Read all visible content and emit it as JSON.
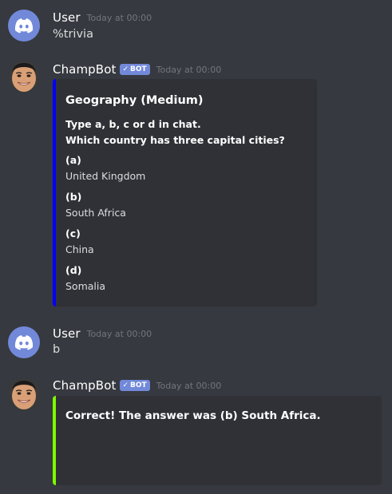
{
  "colors": {
    "background": "#36393f",
    "embed_background": "#2f3136",
    "bot_tag": "#7289da",
    "embed_bar_trivia": "#0000ff",
    "embed_bar_correct": "#7cfc00",
    "timestamp": "#72767d"
  },
  "messages": [
    {
      "author": "User",
      "avatar_icon": "discord-logo-icon",
      "timestamp": "Today at 00:00",
      "content": "%trivia"
    },
    {
      "author": "ChampBot",
      "avatar_icon": "face-avatar-icon",
      "bot_tag": "BOT",
      "bot_check": "✓",
      "timestamp": "Today at 00:00",
      "embed": {
        "title": "Geography (Medium)",
        "instruction": "Type a, b, c or d in chat.",
        "question": "Which country has three capital cities?",
        "options": [
          {
            "label": "(a)",
            "value": "United Kingdom"
          },
          {
            "label": "(b)",
            "value": "South Africa"
          },
          {
            "label": "(c)",
            "value": "China"
          },
          {
            "label": "(d)",
            "value": "Somalia"
          }
        ]
      }
    },
    {
      "author": "User",
      "avatar_icon": "discord-logo-icon",
      "timestamp": "Today at 00:00",
      "content": "b"
    },
    {
      "author": "ChampBot",
      "avatar_icon": "face-avatar-icon",
      "bot_tag": "BOT",
      "bot_check": "✓",
      "timestamp": "Today at 00:00",
      "embed": {
        "title": "Correct! The answer was (b) South Africa."
      }
    }
  ]
}
